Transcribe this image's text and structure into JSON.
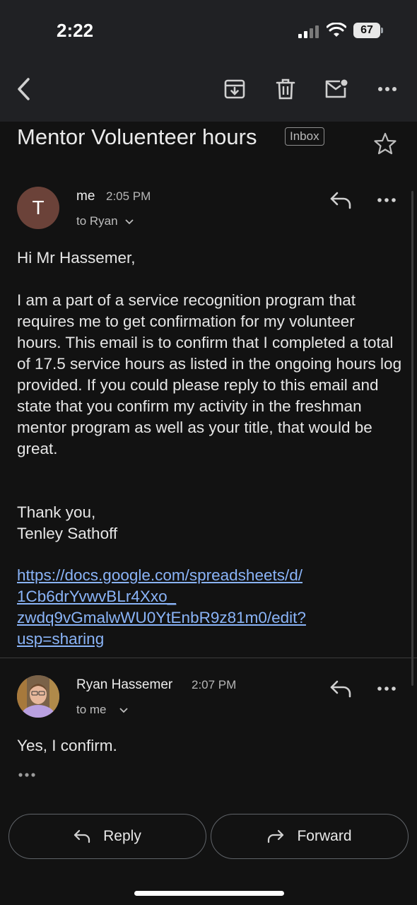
{
  "status_bar": {
    "time": "2:22",
    "battery": "67"
  },
  "toolbar": {
    "back": "back-icon",
    "archive": "archive-icon",
    "delete": "trash-icon",
    "mark_unread": "mark-unread-icon",
    "more": "more-icon"
  },
  "email": {
    "subject": "Mentor Voluenteer hours",
    "label": "Inbox",
    "messages": [
      {
        "avatar_letter": "T",
        "sender": "me",
        "time": "2:05 PM",
        "to": "to Ryan",
        "greeting": "Hi Mr Hassemer,",
        "paragraph": "I am a part of a service recognition program that requires me to get confirmation for my volunteer hours. This email is to confirm that I completed a total of 17.5 service hours as listed in the ongoing hours log provided. If you could please reply to this email and state that you confirm my activity in the freshman mentor program as well as your title, that would be great.",
        "signoff": "Thank you,\nTenley Sathoff",
        "link": "https://docs.google.com/spreadsheets/d/\n1Cb6drYvwvBLr4Xxo_\nzwdq9vGmalwWU0YtEnbR9z81m0/edit?\nusp=sharing"
      },
      {
        "sender": "Ryan Hassemer",
        "time": "2:07 PM",
        "to": "to me",
        "body": "Yes, I confirm."
      }
    ]
  },
  "actions": {
    "reply_label": "Reply",
    "forward_label": "Forward"
  },
  "colors": {
    "background": "#121212",
    "link": "#8ab4f8",
    "avatar_t": "#6b4239"
  }
}
